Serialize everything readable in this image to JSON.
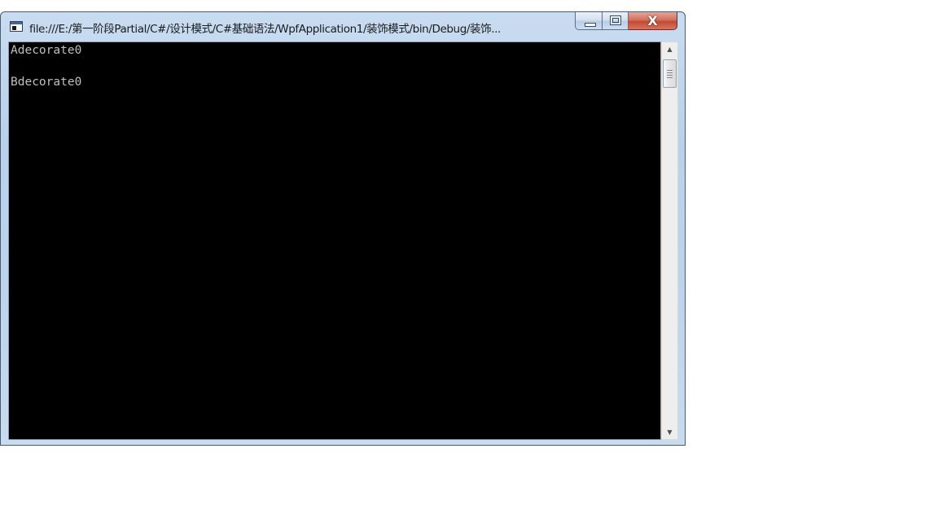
{
  "window": {
    "title": "file:///E:/第一阶段Partial/C#/设计模式/C#基础语法/WpfApplication1/装饰模式/bin/Debug/装饰...",
    "app_icon": "console-app-icon"
  },
  "caption": {
    "minimize_icon": "minimize-icon",
    "maximize_icon": "maximize-icon",
    "close_icon": "close-icon",
    "close_glyph": "X"
  },
  "console": {
    "background_color": "#000000",
    "text_color": "#c0c0c0",
    "lines": [
      "Adecorate0",
      "",
      "Bdecorate0"
    ]
  },
  "scrollbar": {
    "up_glyph": "▲",
    "down_glyph": "▼"
  }
}
